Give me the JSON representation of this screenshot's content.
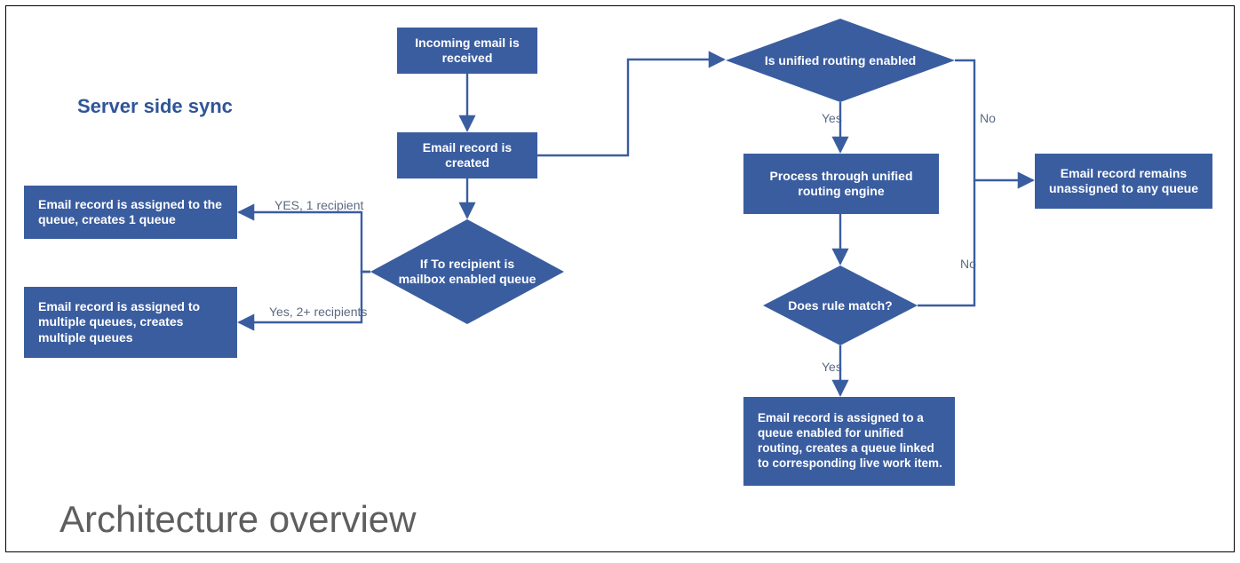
{
  "chart_data": {
    "type": "flowchart",
    "title": "Architecture overview",
    "section_label": "Server side sync",
    "nodes": [
      {
        "id": "n_incoming",
        "type": "process",
        "text": "Incoming email is received"
      },
      {
        "id": "n_created",
        "type": "process",
        "text": "Email record is created"
      },
      {
        "id": "d_mailbox",
        "type": "decision",
        "text": "If To recipient is mailbox enabled queue"
      },
      {
        "id": "n_single_q",
        "type": "process",
        "text": "Email record is assigned to the queue, creates 1 queue"
      },
      {
        "id": "n_multi_q",
        "type": "process",
        "text": "Email record is assigned to multiple queues, creates multiple queues"
      },
      {
        "id": "d_unified",
        "type": "decision",
        "text": "Is unified routing enabled"
      },
      {
        "id": "n_engine",
        "type": "process",
        "text": "Process through unified routing engine"
      },
      {
        "id": "d_rule",
        "type": "decision",
        "text": "Does rule match?"
      },
      {
        "id": "n_assigned_u",
        "type": "process",
        "text": "Email record is assigned to a queue enabled for unified routing, creates a queue linked to corresponding live work item."
      },
      {
        "id": "n_unassigned",
        "type": "process",
        "text": "Email record remains unassigned to any queue"
      }
    ],
    "edges": [
      {
        "from": "n_incoming",
        "to": "n_created",
        "label": ""
      },
      {
        "from": "n_created",
        "to": "d_mailbox",
        "label": ""
      },
      {
        "from": "n_created",
        "to": "d_unified",
        "label": ""
      },
      {
        "from": "d_mailbox",
        "to": "n_single_q",
        "label": "YES, 1 recipient"
      },
      {
        "from": "d_mailbox",
        "to": "n_multi_q",
        "label": "Yes, 2+ recipients"
      },
      {
        "from": "d_unified",
        "to": "n_engine",
        "label": "Yes"
      },
      {
        "from": "d_unified",
        "to": "n_unassigned",
        "label": "No"
      },
      {
        "from": "n_engine",
        "to": "d_rule",
        "label": ""
      },
      {
        "from": "d_rule",
        "to": "n_assigned_u",
        "label": "Yes"
      },
      {
        "from": "d_rule",
        "to": "n_unassigned",
        "label": "No"
      }
    ]
  },
  "colors": {
    "fill": "#3a5da0",
    "stroke": "#2f4f8f",
    "edge": "#3a5da0",
    "text_muted": "#5b6a82"
  }
}
